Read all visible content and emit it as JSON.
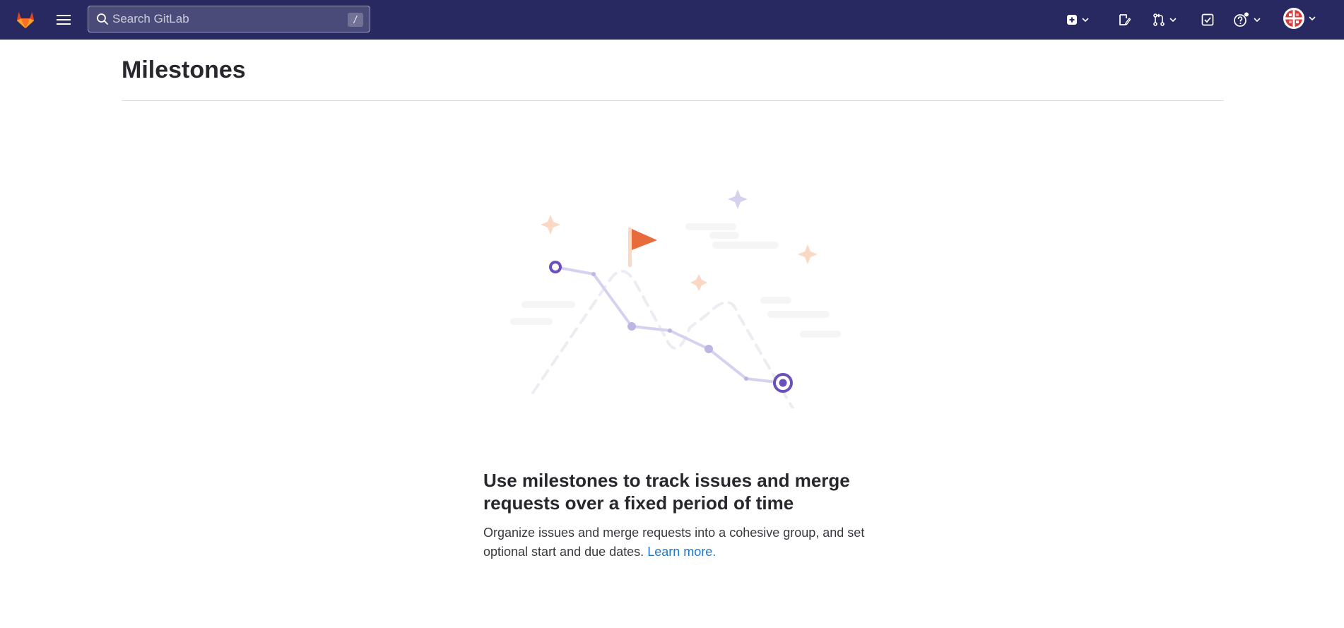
{
  "navbar": {
    "search": {
      "placeholder": "Search GitLab",
      "shortcut": "/"
    }
  },
  "main": {
    "title": "Milestones",
    "empty_state": {
      "heading": "Use milestones to track issues and merge requests over a fixed period of time",
      "description": "Organize issues and merge requests into a cohesive group, and set optional start and due dates.",
      "link_text": "Learn more."
    }
  },
  "colors": {
    "navbar_bg": "#292961",
    "accent_purple": "#6b4fbb",
    "flag_orange": "#e86b3b",
    "link_blue": "#1f75cb"
  },
  "icons": [
    "gitlab-logo",
    "hamburger-icon",
    "search-icon",
    "plus-square-icon",
    "issues-icon",
    "merge-request-icon",
    "todo-icon",
    "help-icon",
    "avatar",
    "chevron-down-icon"
  ]
}
